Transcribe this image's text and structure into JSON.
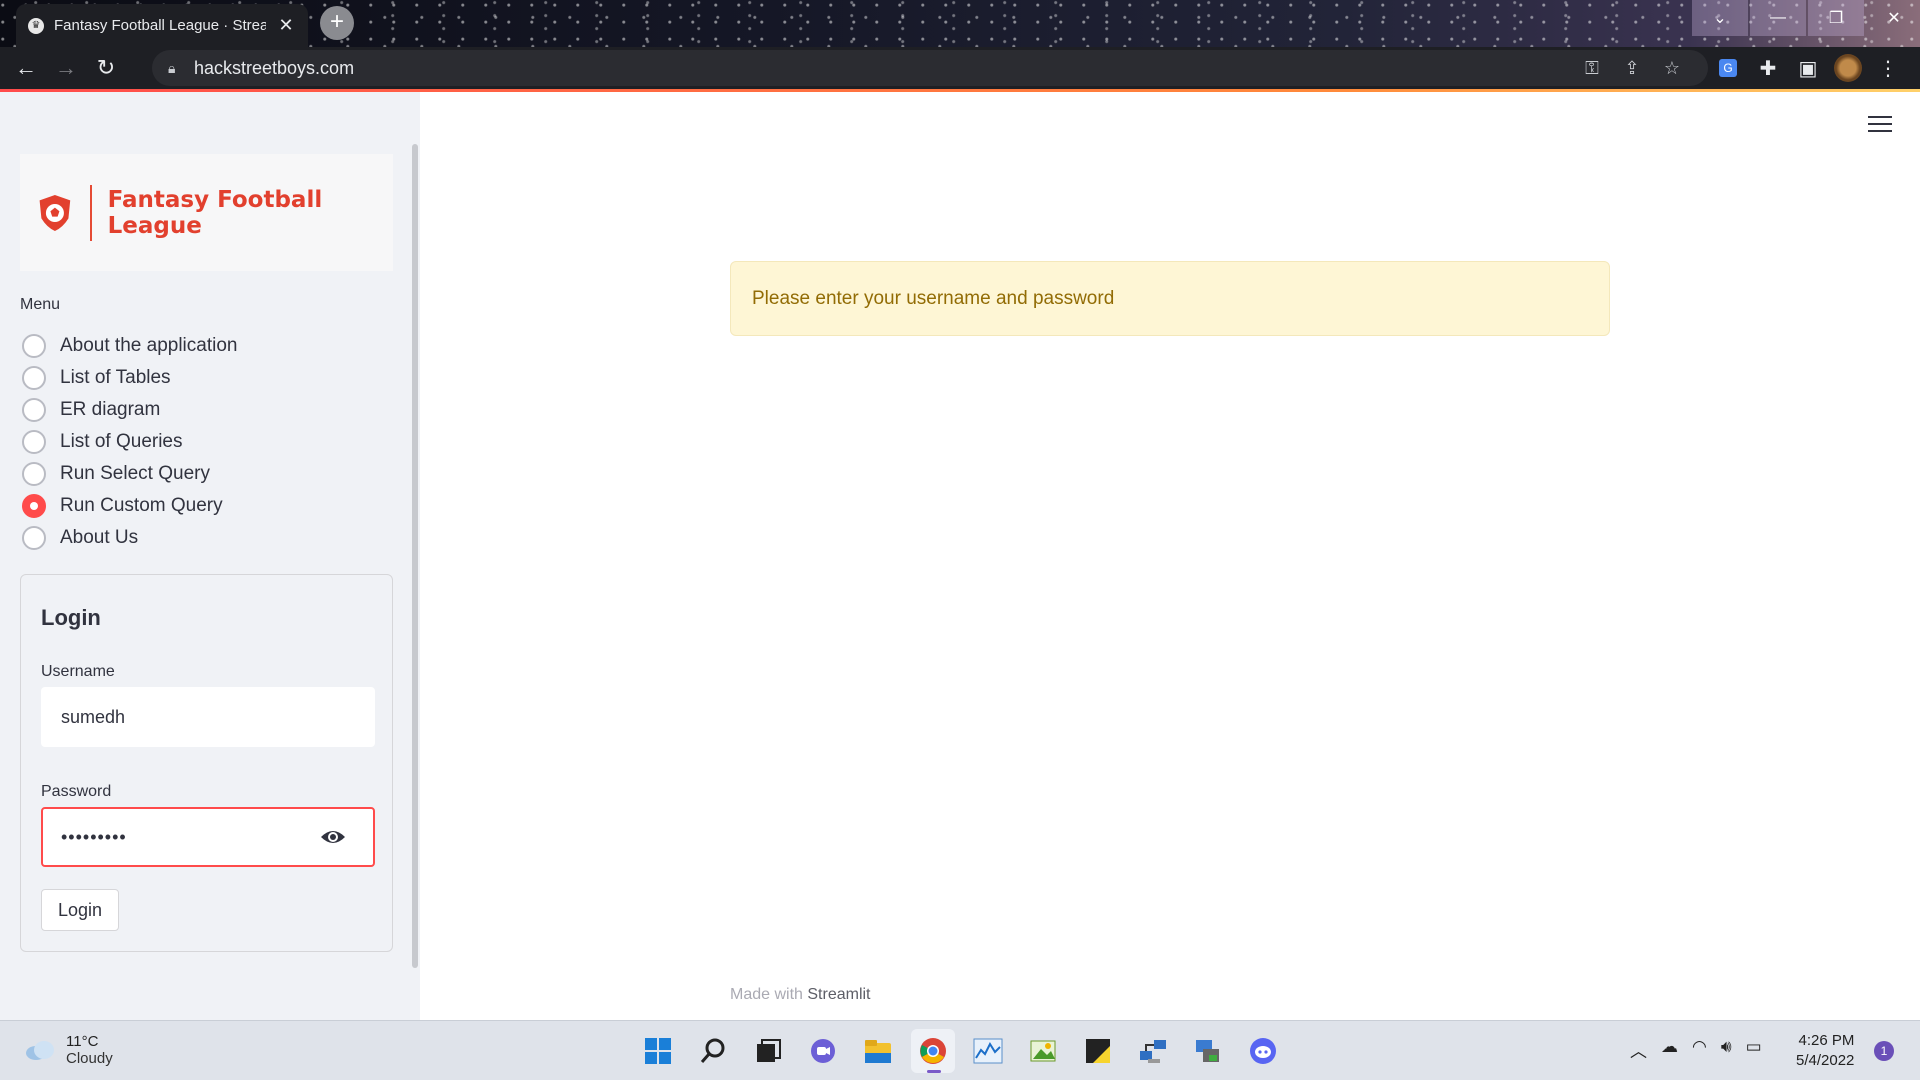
{
  "browser": {
    "tab_title": "Fantasy Football League · Streamlit",
    "new_tab_label": "+",
    "url": "hackstreetboys.com"
  },
  "sidebar": {
    "logo_text": "Fantasy Football League",
    "menu_label": "Menu",
    "menu_items": [
      {
        "label": "About the application",
        "selected": false
      },
      {
        "label": "List of Tables",
        "selected": false
      },
      {
        "label": "ER diagram",
        "selected": false
      },
      {
        "label": "List of Queries",
        "selected": false
      },
      {
        "label": "Run Select Query",
        "selected": false
      },
      {
        "label": "Run Custom Query",
        "selected": true
      },
      {
        "label": "About Us",
        "selected": false
      }
    ],
    "login": {
      "title": "Login",
      "username_label": "Username",
      "username_value": "sumedh",
      "password_label": "Password",
      "password_value": "•••••••••",
      "button_label": "Login"
    }
  },
  "main": {
    "alert_text": "Please enter your username and password",
    "footer_prefix": "Made with",
    "footer_link": "Streamlit"
  },
  "taskbar": {
    "weather_temp": "11°C",
    "weather_desc": "Cloudy",
    "time": "4:26 PM",
    "date": "5/4/2022",
    "notification_count": "1",
    "apps": [
      "start-icon",
      "search-icon",
      "task-view-icon",
      "teams-chat-icon",
      "file-explorer-icon",
      "chrome-icon",
      "resource-monitor-icon",
      "photos-icon",
      "sticky-notes-icon",
      "network-tool-icon",
      "vpn-tool-icon",
      "discord-icon"
    ]
  },
  "colors": {
    "accent": "#ff4b4b",
    "logo_red": "#e2402e",
    "alert_bg": "#fef6d5",
    "alert_text": "#926c05",
    "sidebar_bg": "#f0f2f6"
  }
}
